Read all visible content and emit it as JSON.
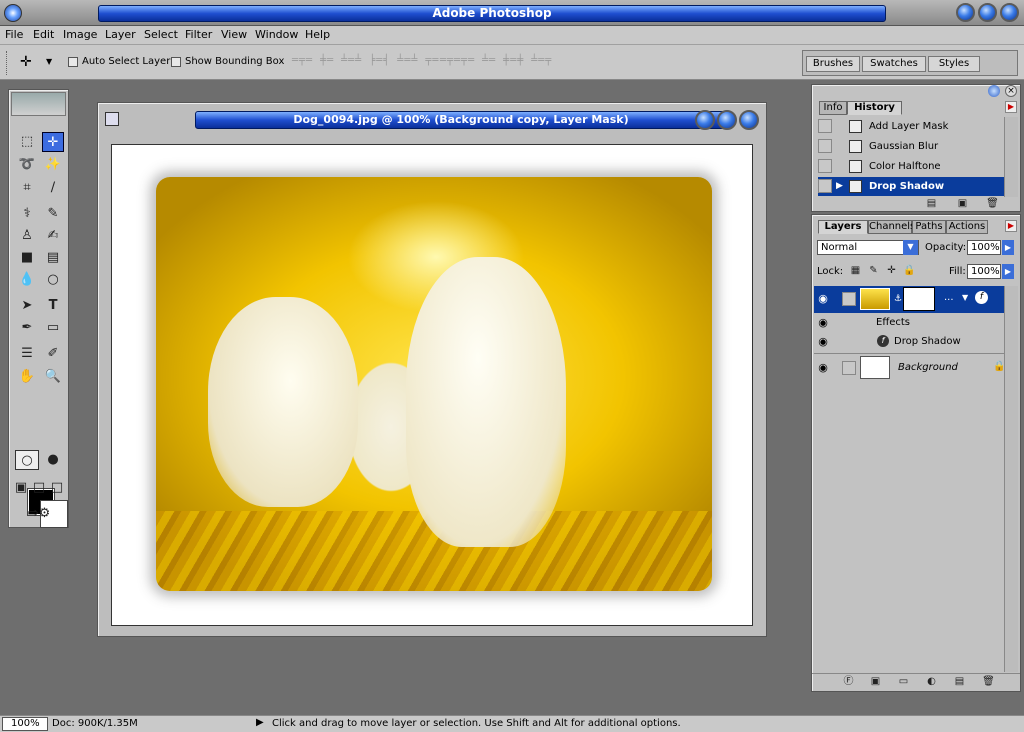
{
  "app": {
    "title": "Adobe Photoshop"
  },
  "menu": [
    "File",
    "Edit",
    "Image",
    "Layer",
    "Select",
    "Filter",
    "View",
    "Window",
    "Help"
  ],
  "options": {
    "auto_select": "Auto Select Layer",
    "show_bounding": "Show Bounding Box"
  },
  "palette_well": {
    "tabs": [
      "Brushes",
      "Swatches",
      "Styles"
    ]
  },
  "document": {
    "title": "Dog_0094.jpg @ 100% (Background copy, Layer Mask)"
  },
  "history_panel": {
    "tabs": [
      "Info",
      "History"
    ],
    "items": [
      "Add Layer Mask",
      "Gaussian Blur",
      "Color Halftone",
      "Drop Shadow"
    ],
    "selected": 3
  },
  "layers_panel": {
    "tabs": [
      "Layers",
      "Channels",
      "Paths",
      "Actions"
    ],
    "blend_mode": "Normal",
    "opacity_label": "Opacity:",
    "opacity_value": "100%",
    "lock_label": "Lock:",
    "fill_label": "Fill:",
    "fill_value": "100%",
    "effects_label": "Effects",
    "effect_name": "Drop Shadow",
    "background_label": "Background"
  },
  "status": {
    "zoom": "100%",
    "doc": "Doc: 900K/1.35M",
    "hint": "Click and drag to move layer or selection.  Use Shift and Alt for additional options."
  },
  "colors": {
    "title_blue": "#1f4fd0",
    "selection_blue": "#0a3c9c",
    "chrome_gray": "#c2c2c2"
  }
}
